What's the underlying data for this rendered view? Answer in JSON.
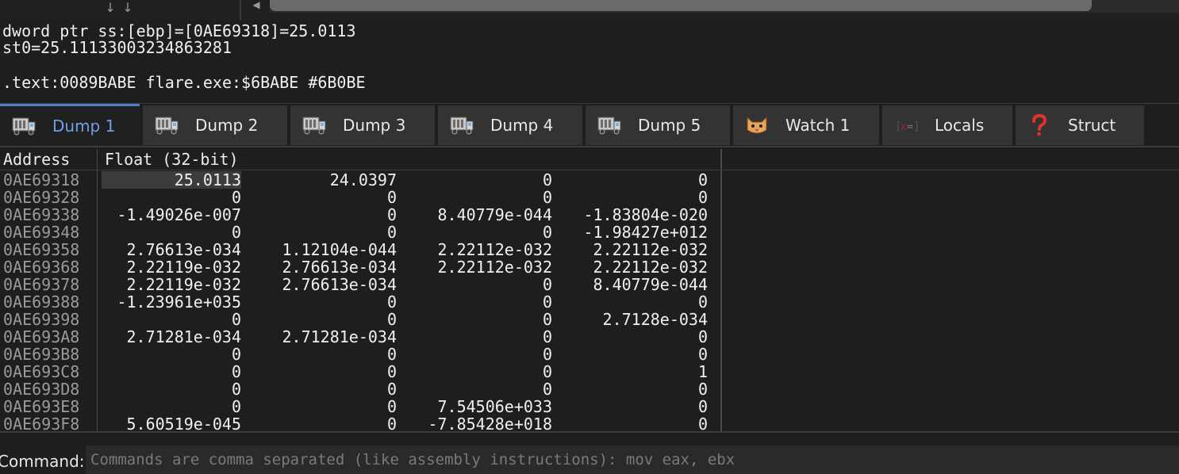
{
  "info": {
    "line1": "dword ptr ss:[ebp]=[0AE69318]=25.0113",
    "line2": "st0=25.11133003234863281",
    "line3": ".text:0089BABE flare.exe:$6BABE #6B0BE"
  },
  "tabs": [
    {
      "label": "Dump 1",
      "icon": "dump-icon",
      "active": true
    },
    {
      "label": "Dump 2",
      "icon": "dump-icon",
      "active": false
    },
    {
      "label": "Dump 3",
      "icon": "dump-icon",
      "active": false
    },
    {
      "label": "Dump 4",
      "icon": "dump-icon",
      "active": false
    },
    {
      "label": "Dump 5",
      "icon": "dump-icon",
      "active": false
    },
    {
      "label": "Watch 1",
      "icon": "cat-icon",
      "active": false
    },
    {
      "label": "Locals",
      "icon": "locals-icon",
      "active": false
    },
    {
      "label": "Struct",
      "icon": "question-icon",
      "active": false
    }
  ],
  "dump": {
    "address_header": "Address",
    "format_header": "Float (32-bit)",
    "selected": {
      "row": 0,
      "col": 0
    },
    "rows": [
      {
        "address": "0AE69318",
        "values": [
          "25.0113",
          "24.0397",
          "0",
          "0"
        ]
      },
      {
        "address": "0AE69328",
        "values": [
          "0",
          "0",
          "0",
          "0"
        ]
      },
      {
        "address": "0AE69338",
        "values": [
          "-1.49026e-007",
          "0",
          "8.40779e-044",
          "-1.83804e-020"
        ]
      },
      {
        "address": "0AE69348",
        "values": [
          "0",
          "0",
          "0",
          "-1.98427e+012"
        ]
      },
      {
        "address": "0AE69358",
        "values": [
          "2.76613e-034",
          "1.12104e-044",
          "2.22112e-032",
          "2.22112e-032"
        ]
      },
      {
        "address": "0AE69368",
        "values": [
          "2.22119e-032",
          "2.76613e-034",
          "2.22112e-032",
          "2.22112e-032"
        ]
      },
      {
        "address": "0AE69378",
        "values": [
          "2.22119e-032",
          "2.76613e-034",
          "0",
          "8.40779e-044"
        ]
      },
      {
        "address": "0AE69388",
        "values": [
          "-1.23961e+035",
          "0",
          "0",
          "0"
        ]
      },
      {
        "address": "0AE69398",
        "values": [
          "0",
          "0",
          "0",
          "2.7128e-034"
        ]
      },
      {
        "address": "0AE693A8",
        "values": [
          "2.71281e-034",
          "2.71281e-034",
          "0",
          "0"
        ]
      },
      {
        "address": "0AE693B8",
        "values": [
          "0",
          "0",
          "0",
          "0"
        ]
      },
      {
        "address": "0AE693C8",
        "values": [
          "0",
          "0",
          "0",
          "1"
        ]
      },
      {
        "address": "0AE693D8",
        "values": [
          "0",
          "0",
          "0",
          "0"
        ]
      },
      {
        "address": "0AE693E8",
        "values": [
          "0",
          "0",
          "7.54506e+033",
          "0"
        ]
      },
      {
        "address": "0AE693F8",
        "values": [
          "5.60519e-045",
          "0",
          "-7.85428e+018",
          "0"
        ]
      }
    ]
  },
  "command": {
    "label": "Command:",
    "placeholder": "Commands are comma separated (like assembly instructions): mov eax, ebx"
  },
  "colors": {
    "background": "#1e1e1e",
    "active_tab_text": "#6fa0e6",
    "tab_bg": "#333333",
    "address_text": "#9a9a9a"
  }
}
